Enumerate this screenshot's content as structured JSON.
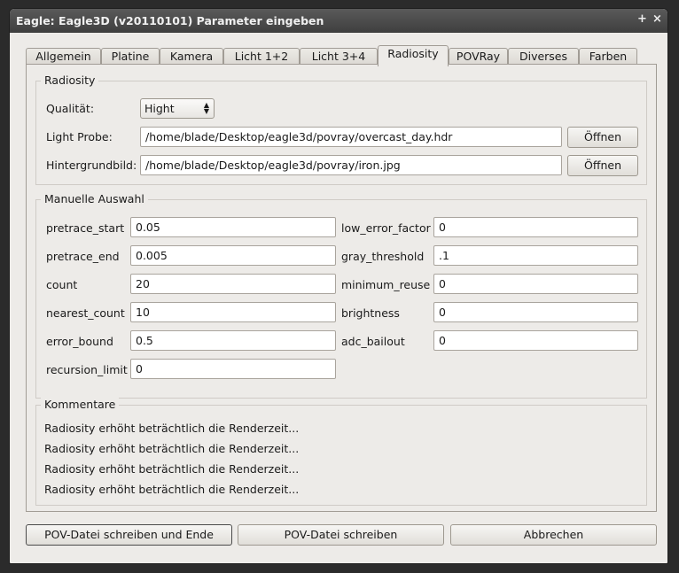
{
  "window": {
    "title": "Eagle: Eagle3D (v20110101) Parameter eingeben",
    "maximize_glyph": "+",
    "close_glyph": "×"
  },
  "tabs": [
    "Allgemein",
    "Platine",
    "Kamera",
    "Licht 1+2",
    "Licht 3+4",
    "Radiosity",
    "POVRay",
    "Diverses",
    "Farben"
  ],
  "active_tab": "Radiosity",
  "radiosity": {
    "legend": "Radiosity",
    "quality_label": "Qualität:",
    "quality_value": "Hight",
    "light_probe_label": "Light Probe:",
    "light_probe_value": "/home/blade/Desktop/eagle3d/povray/overcast_day.hdr",
    "background_label": "Hintergrundbild:",
    "background_value": "/home/blade/Desktop/eagle3d/povray/iron.jpg",
    "open_label": "Öffnen"
  },
  "manual": {
    "legend": "Manuelle Auswahl",
    "left": [
      {
        "label": "pretrace_start",
        "value": "0.05"
      },
      {
        "label": "pretrace_end",
        "value": "0.005"
      },
      {
        "label": "count",
        "value": "20"
      },
      {
        "label": "nearest_count",
        "value": "10"
      },
      {
        "label": "error_bound",
        "value": "0.5"
      },
      {
        "label": "recursion_limit",
        "value": "0"
      }
    ],
    "right": [
      {
        "label": "low_error_factor",
        "value": "0"
      },
      {
        "label": "gray_threshold",
        "value": ".1"
      },
      {
        "label": "minimum_reuse",
        "value": "0"
      },
      {
        "label": "brightness",
        "value": "0"
      },
      {
        "label": "adc_bailout",
        "value": "0"
      }
    ]
  },
  "comments": {
    "legend": "Kommentare",
    "lines": [
      "Radiosity erhöht beträchtlich die Renderzeit...",
      "Radiosity erhöht beträchtlich die Renderzeit...",
      "Radiosity erhöht beträchtlich die Renderzeit...",
      "Radiosity erhöht beträchtlich die Renderzeit..."
    ]
  },
  "footer": {
    "write_and_exit": "POV-Datei schreiben und Ende",
    "write": "POV-Datei schreiben",
    "cancel": "Abbrechen"
  }
}
